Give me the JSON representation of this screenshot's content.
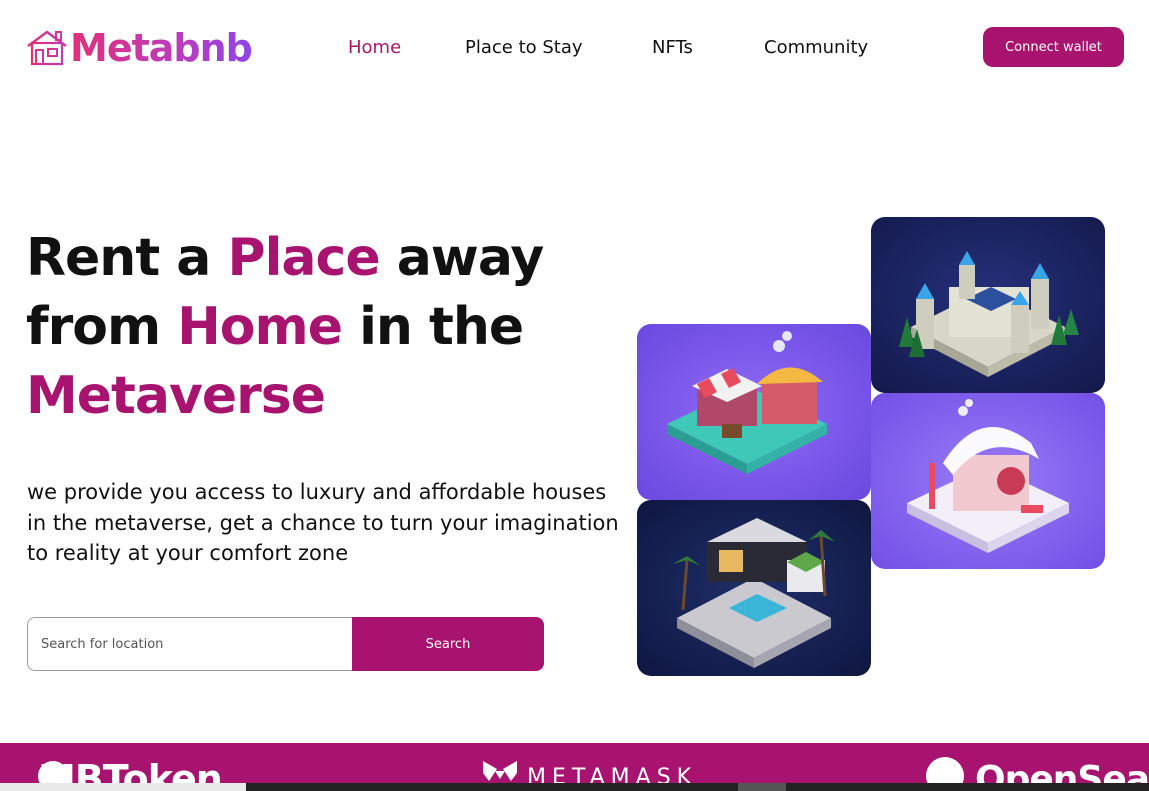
{
  "logo": {
    "text": "Metabnb",
    "icon": "house-icon"
  },
  "nav": {
    "links": [
      {
        "label": "Home",
        "active": true
      },
      {
        "label": "Place to Stay",
        "active": false
      },
      {
        "label": "NFTs",
        "active": false
      },
      {
        "label": "Community",
        "active": false
      }
    ],
    "connect_label": "Connect wallet"
  },
  "hero": {
    "title_parts": [
      "Rent a ",
      "Place",
      " away from ",
      "Home",
      " in the ",
      "Metaverse"
    ],
    "description": "we provide you access to luxury and affordable houses in the metaverse, get a chance to turn your imagination to reality at your comfort zone"
  },
  "search": {
    "placeholder": "Search for location",
    "button_label": "Search"
  },
  "cards": [
    {
      "name": "castle-image"
    },
    {
      "name": "market-stall-image"
    },
    {
      "name": "snow-cottage-image"
    },
    {
      "name": "modern-villa-image"
    }
  ],
  "brands": {
    "mbtoken": "MBToken",
    "metamask": "METAMASK",
    "opensea": "OpenSea"
  },
  "colors": {
    "accent": "#a8136f",
    "logo_gradient_start": "#e0307a",
    "logo_gradient_end": "#8f45e8"
  }
}
